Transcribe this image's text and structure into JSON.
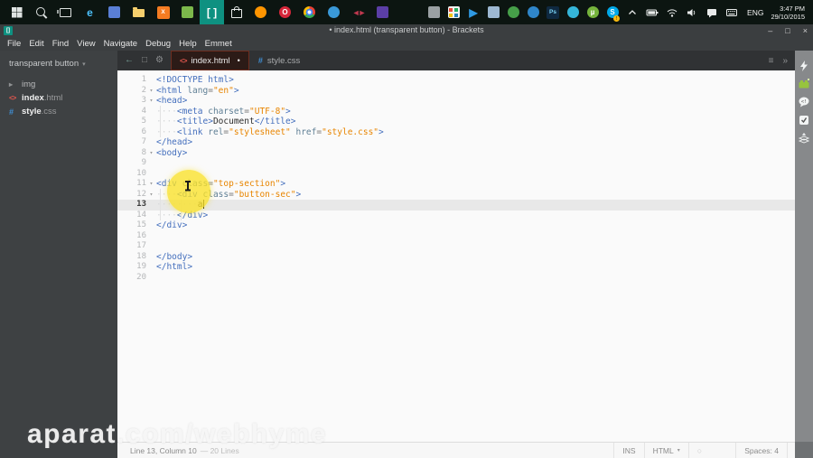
{
  "taskbar": {
    "language": "ENG",
    "time": "3:47 PM",
    "date": "29/10/2015",
    "left_icons": [
      {
        "name": "start",
        "kind": "start"
      },
      {
        "name": "search",
        "kind": "search"
      },
      {
        "name": "task-view",
        "kind": "taskview"
      },
      {
        "name": "edge",
        "kind": "glyph",
        "glyph": "e",
        "fg": "#4cc2ff"
      },
      {
        "name": "notes-app",
        "kind": "sq",
        "bg": "#5a7fd6"
      },
      {
        "name": "file-explorer",
        "kind": "folder"
      },
      {
        "name": "xampp",
        "kind": "tile",
        "glyph": "X",
        "fg": "#ffffff",
        "bg": "#f57c22"
      },
      {
        "name": "photos",
        "kind": "sq",
        "bg": "#7cb84b"
      },
      {
        "name": "brackets",
        "kind": "glyph",
        "glyph": "[ ]",
        "fg": "#ffffff",
        "active": true
      },
      {
        "name": "store",
        "kind": "store"
      },
      {
        "name": "firefox",
        "kind": "circle",
        "bg": "#ff9500"
      },
      {
        "name": "opera",
        "kind": "circleg",
        "glyph": "O",
        "bg": "#d6273a"
      },
      {
        "name": "chrome",
        "kind": "chrome"
      },
      {
        "name": "safari",
        "kind": "circle",
        "bg": "#3a99d8"
      },
      {
        "name": "media-player",
        "kind": "bowtie",
        "glyph": "◄►"
      },
      {
        "name": "purple-app",
        "kind": "sq",
        "bg": "#5b3ea6"
      }
    ],
    "right_icons": [
      {
        "name": "barcode-app",
        "kind": "sq",
        "bg": "#9aa0a3"
      },
      {
        "name": "color-grid-app",
        "kind": "grid"
      },
      {
        "name": "bsplayer",
        "kind": "glyph",
        "glyph": "▶",
        "fg": "#2f9ae3"
      },
      {
        "name": "word",
        "kind": "sq",
        "bg": "#9db8d2"
      },
      {
        "name": "idm",
        "kind": "circle",
        "bg": "#46a049"
      },
      {
        "name": "blue-app",
        "kind": "circle",
        "bg": "#2f86c9"
      },
      {
        "name": "photoshop",
        "kind": "tile",
        "glyph": "Ps",
        "fg": "#7cd6f7",
        "bg": "#0f2940"
      },
      {
        "name": "cyan-app",
        "kind": "circle",
        "bg": "#35b6d9"
      },
      {
        "name": "utorrent",
        "kind": "circleg",
        "glyph": "µ",
        "bg": "#76b43c"
      },
      {
        "name": "skype",
        "kind": "circleg",
        "glyph": "S",
        "bg": "#00a8e8",
        "badge": true
      }
    ],
    "tray_icons": [
      {
        "name": "tray-expand-chevron",
        "kind": "svg",
        "svg": "chevron"
      },
      {
        "name": "battery",
        "kind": "svg",
        "svg": "battery"
      },
      {
        "name": "wifi",
        "kind": "svg",
        "svg": "wifi"
      },
      {
        "name": "volume",
        "kind": "svg",
        "svg": "speaker"
      },
      {
        "name": "notifications",
        "kind": "svg",
        "svg": "chat"
      },
      {
        "name": "touch-keyboard",
        "kind": "svg",
        "svg": "keyboard"
      }
    ]
  },
  "window": {
    "title": "• index.html (transparent button) - Brackets",
    "app_icon": "[]"
  },
  "menu": {
    "items": [
      "File",
      "Edit",
      "Find",
      "View",
      "Navigate",
      "Debug",
      "Help",
      "Emmet"
    ]
  },
  "sidebar": {
    "project": "transparent button",
    "files": [
      {
        "icon": "folder",
        "base": "img",
        "ext": "",
        "dim": true
      },
      {
        "icon": "html",
        "base": "index",
        "ext": ".html",
        "dim": false
      },
      {
        "icon": "css",
        "base": "style",
        "ext": ".css",
        "dim": false
      }
    ]
  },
  "tabbar": {
    "left_buttons": [
      {
        "name": "back-arrow",
        "glyph": "back"
      },
      {
        "name": "split-view",
        "glyph": "split"
      },
      {
        "name": "working-set-settings-gear",
        "glyph": "gear"
      }
    ],
    "tabs": [
      {
        "icon": "html",
        "label": "index.html",
        "dirty": true,
        "active": true
      },
      {
        "icon": "css",
        "label": "style.css",
        "dirty": false,
        "active": false
      }
    ],
    "right_buttons": [
      {
        "name": "working-set-menu",
        "glyph": "menu"
      },
      {
        "name": "overflow-chevrons",
        "glyph": "chev"
      }
    ]
  },
  "editor": {
    "lines": [
      {
        "n": 1,
        "seg": [
          [
            "t",
            "<!DOCTYPE html>"
          ]
        ]
      },
      {
        "n": 2,
        "fold": true,
        "seg": [
          [
            "t",
            "<html"
          ],
          [
            "a",
            " lang"
          ],
          [
            "p",
            "="
          ],
          [
            "s",
            "\"en\""
          ],
          [
            "t",
            ">"
          ]
        ]
      },
      {
        "n": 3,
        "fold": true,
        "seg": [
          [
            "t",
            "<head>"
          ]
        ]
      },
      {
        "n": 4,
        "seg": [
          [
            "w",
            "····"
          ],
          [
            "t",
            "<meta"
          ],
          [
            "a",
            " charset"
          ],
          [
            "p",
            "="
          ],
          [
            "s",
            "\"UTF-8\""
          ],
          [
            "t",
            ">"
          ]
        ]
      },
      {
        "n": 5,
        "seg": [
          [
            "w",
            "····"
          ],
          [
            "t",
            "<title>"
          ],
          [
            "x",
            "Document"
          ],
          [
            "t",
            "</title>"
          ]
        ]
      },
      {
        "n": 6,
        "seg": [
          [
            "w",
            "····"
          ],
          [
            "t",
            "<link"
          ],
          [
            "a",
            " rel"
          ],
          [
            "p",
            "="
          ],
          [
            "s",
            "\"stylesheet\""
          ],
          [
            "a",
            " href"
          ],
          [
            "p",
            "="
          ],
          [
            "s",
            "\"style.css\""
          ],
          [
            "t",
            ">"
          ]
        ]
      },
      {
        "n": 7,
        "seg": [
          [
            "t",
            "</head>"
          ]
        ]
      },
      {
        "n": 8,
        "fold": true,
        "seg": [
          [
            "t",
            "<body>"
          ]
        ]
      },
      {
        "n": 9,
        "seg": []
      },
      {
        "n": 10,
        "seg": []
      },
      {
        "n": 11,
        "fold": true,
        "seg": [
          [
            "t",
            "<div"
          ],
          [
            "a",
            " class"
          ],
          [
            "p",
            "="
          ],
          [
            "s",
            "\"top-section\""
          ],
          [
            "t",
            ">"
          ]
        ]
      },
      {
        "n": 12,
        "fold": true,
        "seg": [
          [
            "w",
            "····"
          ],
          [
            "t",
            "<div"
          ],
          [
            "a",
            " class"
          ],
          [
            "p",
            "="
          ],
          [
            "s",
            "\"button-sec\""
          ],
          [
            "t",
            ">"
          ]
        ]
      },
      {
        "n": 13,
        "active": true,
        "seg": [
          [
            "w",
            "········"
          ],
          [
            "x",
            "a"
          ],
          [
            "caret",
            ""
          ]
        ]
      },
      {
        "n": 14,
        "seg": [
          [
            "w",
            "····"
          ],
          [
            "t",
            "</div>"
          ]
        ]
      },
      {
        "n": 15,
        "seg": [
          [
            "t",
            "</div>"
          ]
        ]
      },
      {
        "n": 16,
        "seg": []
      },
      {
        "n": 17,
        "seg": []
      },
      {
        "n": 18,
        "seg": [
          [
            "t",
            "</body>"
          ]
        ]
      },
      {
        "n": 19,
        "seg": [
          [
            "t",
            "</html>"
          ]
        ]
      },
      {
        "n": 20,
        "seg": []
      }
    ]
  },
  "toolbar": {
    "items": [
      {
        "name": "live-preview",
        "svg": "bolt"
      },
      {
        "name": "extension-manager",
        "svg": "brick"
      },
      {
        "name": "code-comments",
        "svg": "bubble"
      },
      {
        "name": "todo-checkmark",
        "svg": "check"
      },
      {
        "name": "upload-layers",
        "svg": "layers"
      }
    ]
  },
  "statusbar": {
    "position": "Line 13, Column 10",
    "lines_info": "— 20 Lines",
    "overwrite": "INS",
    "language": "HTML",
    "spaces": "Spaces: 4"
  },
  "watermark": {
    "text": "aparat.com/webhyme"
  },
  "colors": {
    "accent_teal": "#0e9181",
    "active_tab_red": "#e2574e",
    "css_icon_blue": "#3f8fd5",
    "tag_blue": "#446fbd",
    "string_orange": "#e88501",
    "taskbar_bg": "#0c1511",
    "chrome_bg": "#3b3e40",
    "sidebar_bg": "#3e4143"
  }
}
